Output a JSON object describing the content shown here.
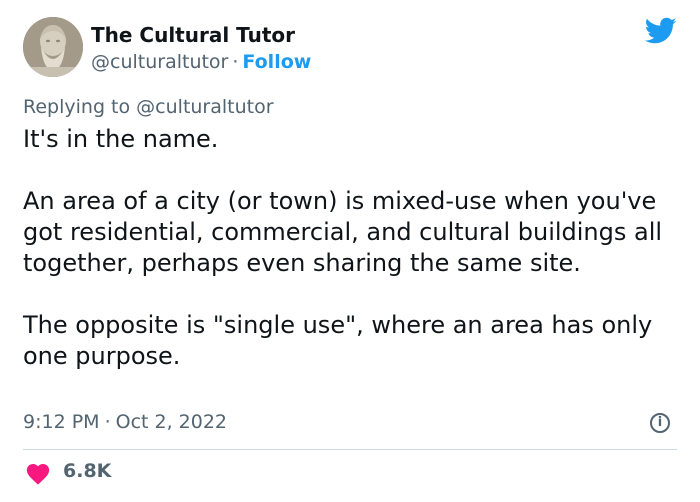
{
  "author": {
    "name": "The Cultural Tutor",
    "handle": "@culturaltutor",
    "separator": "·",
    "follow_label": "Follow"
  },
  "reply": {
    "prefix": "Replying to",
    "mention": "@culturaltutor"
  },
  "tweet": {
    "paragraphs": [
      "It's in the name.",
      "An area of a city (or town) is mixed-use when you've got residential, commercial, and cultural buildings all together, perhaps even sharing the same site.",
      "The opposite is \"single use\", where an area has only one purpose."
    ],
    "time": "9:12 PM",
    "time_separator": "·",
    "date": "Oct 2, 2022"
  },
  "stats": {
    "likes": "6.8K"
  },
  "icons": {
    "brand": "twitter-bird-icon",
    "info": "info-icon",
    "like": "heart-icon"
  },
  "colors": {
    "accent": "#1d9bf0",
    "like": "#f91880",
    "secondary_text": "#536471",
    "primary_text": "#0f1419"
  }
}
